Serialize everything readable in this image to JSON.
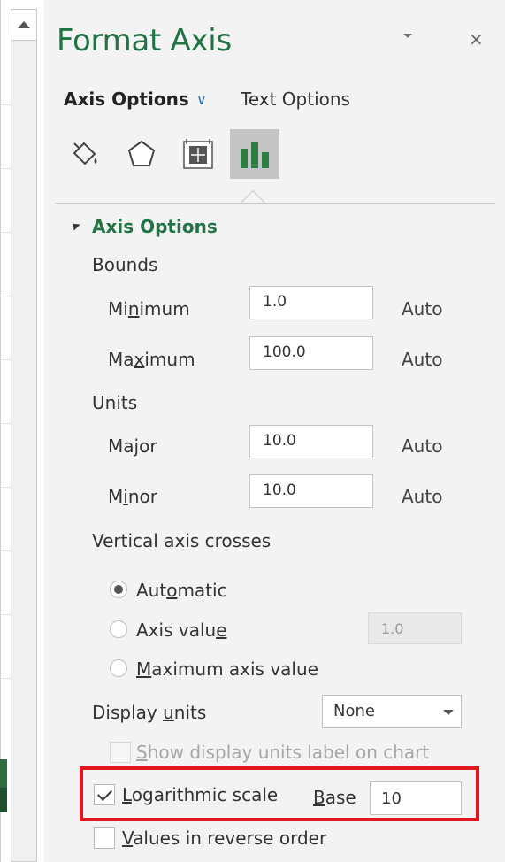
{
  "pane": {
    "title": "Format Axis",
    "close_glyph": "×",
    "tabs": {
      "axis_options": "Axis Options",
      "text_options": "Text Options",
      "chevron_glyph": "∨"
    },
    "icons": [
      "fill-line-icon",
      "effects-icon",
      "size-properties-icon",
      "axis-options-icon"
    ]
  },
  "axis_options": {
    "section_title": "Axis Options",
    "bounds": {
      "heading": "Bounds",
      "minimum": {
        "label_pre": "Mi",
        "label_u": "n",
        "label_post": "imum",
        "value": "1.0",
        "auto": "Auto"
      },
      "maximum": {
        "label_pre": "Ma",
        "label_u": "x",
        "label_post": "imum",
        "value": "100.0",
        "auto": "Auto"
      }
    },
    "units": {
      "heading": "Units",
      "major": {
        "label_pre": "Ma",
        "label_u": "j",
        "label_post": "or",
        "value": "10.0",
        "auto": "Auto"
      },
      "minor": {
        "label_pre": "M",
        "label_u": "i",
        "label_post": "nor",
        "value": "10.0",
        "auto": "Auto"
      }
    },
    "vertical_axis_crosses": {
      "heading": "Vertical axis crosses",
      "automatic": {
        "label_pre": "Aut",
        "label_u": "o",
        "label_post": "matic",
        "checked": true
      },
      "axis_value": {
        "label_pre": "Axis valu",
        "label_u": "e",
        "label_post": "",
        "value": "1.0",
        "checked": false
      },
      "maximum_axis_value": {
        "label_pre": "",
        "label_u": "M",
        "label_post": "aximum axis value",
        "checked": false
      }
    },
    "display_units": {
      "label_pre": "Display ",
      "label_u": "u",
      "label_post": "nits",
      "selected": "None"
    },
    "show_units_label": {
      "label_pre": "",
      "label_u": "S",
      "label_post": "how display units label on chart",
      "checked": false,
      "disabled": true
    },
    "logarithmic_scale": {
      "label_pre": "",
      "label_u": "L",
      "label_post": "ogarithmic scale",
      "checked": true,
      "base_label_pre": "",
      "base_label_u": "B",
      "base_label_post": "ase",
      "base_value": "10"
    },
    "reverse_order": {
      "label_pre": "",
      "label_u": "V",
      "label_post": "alues in reverse order",
      "checked": false
    }
  },
  "colors": {
    "accent_green": "#217346",
    "highlight_red": "#e0171e",
    "selected_tab_bg": "#c4c4c4"
  }
}
